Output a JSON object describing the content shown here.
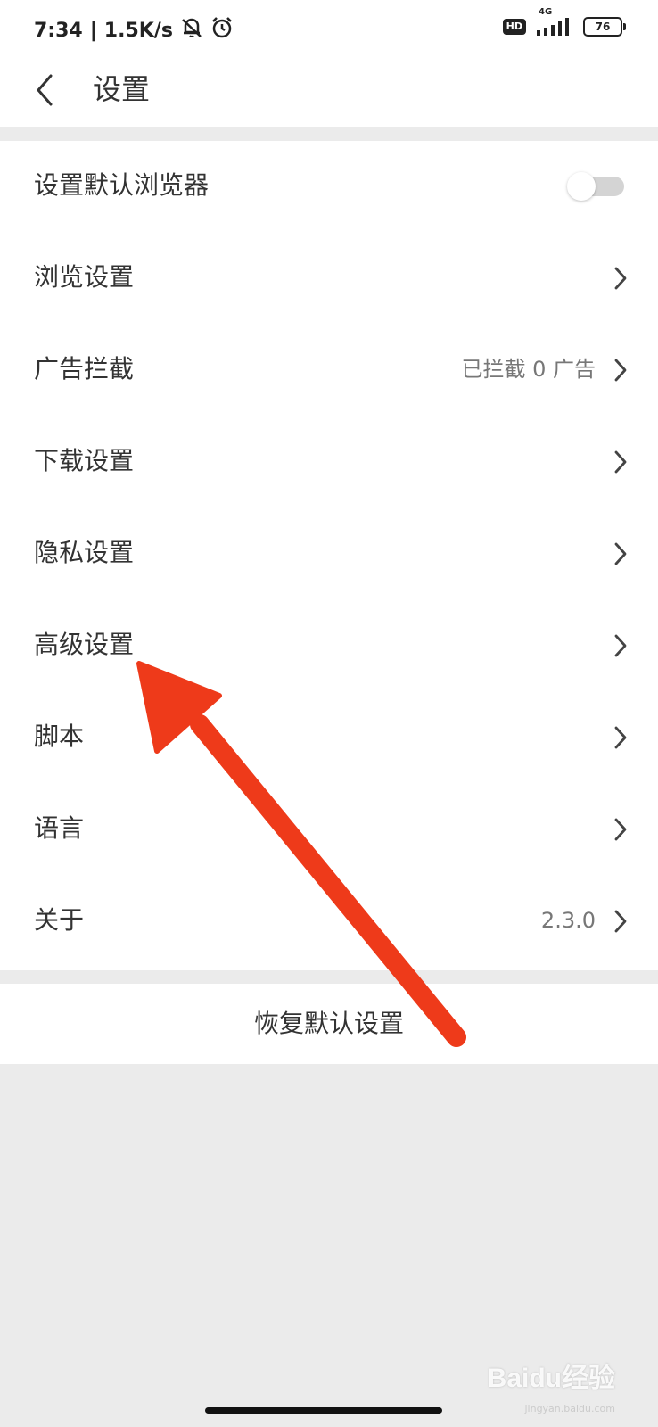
{
  "status_bar": {
    "time": "7:34",
    "separator": "|",
    "net_speed": "1.5K/s",
    "hd_label": "HD",
    "network_type": "4G",
    "battery_level": "76",
    "icons": [
      "bell-muted-icon",
      "alarm-icon",
      "hd-icon",
      "signal-icon",
      "battery-icon"
    ]
  },
  "header": {
    "title": "设置",
    "back_icon": "chevron-left-icon"
  },
  "settings": {
    "items": [
      {
        "label": "设置默认浏览器",
        "control": "toggle",
        "toggle_on": false
      },
      {
        "label": "浏览设置",
        "control": "chevron"
      },
      {
        "label": "广告拦截",
        "value": "已拦截 0 广告",
        "control": "chevron"
      },
      {
        "label": "下载设置",
        "control": "chevron"
      },
      {
        "label": "隐私设置",
        "control": "chevron"
      },
      {
        "label": "高级设置",
        "control": "chevron"
      },
      {
        "label": "脚本",
        "control": "chevron"
      },
      {
        "label": "语言",
        "control": "chevron"
      },
      {
        "label": "关于",
        "value": "2.3.0",
        "control": "chevron"
      }
    ]
  },
  "restore": {
    "label": "恢复默认设置"
  },
  "annotation": {
    "arrow_color": "#ee3a1a",
    "points_to": "高级设置"
  },
  "watermark": {
    "text": "Baidu经验",
    "sub": "jingyan.baidu.com"
  },
  "colors": {
    "background": "#ebebeb",
    "surface": "#ffffff",
    "text_primary": "#333333",
    "text_secondary": "#777777",
    "toggle_off": "#d4d4d4"
  }
}
